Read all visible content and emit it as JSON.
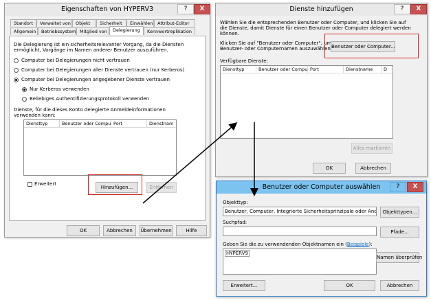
{
  "dialog_properties": {
    "title": "Eigenschaften von HYPERV3",
    "help_btn": "?",
    "close_btn": "X",
    "tabs_row1": [
      "Standort",
      "Verwaltet von",
      "Objekt",
      "Sicherheit",
      "Einwählen",
      "Attribut-Editor"
    ],
    "tabs_row2": [
      "Allgemein",
      "Betriebssystem",
      "Mitglied von",
      "Delegierung",
      "Kennwortreplikation"
    ],
    "intro_line1": "Die Delegierung ist ein sicherheitsrelevanter Vorgang, da die Diensten",
    "intro_line2": "ermöglicht, Vorgänge im Namen anderer Benutzer auszuführen.",
    "radio_no_trust": "Computer bei Delegierungen nicht vertrauen",
    "radio_all": "Computer bei Delegierungen aller Dienste vertrauen (nur Kerberos)",
    "radio_specific": "Computer bei Delegierungen angegebener Dienste vertrauen",
    "radio_kerberos": "Nur Kerberos verwenden",
    "radio_any_protocol": "Beliebiges Authentifizierungsprotokoll verwenden",
    "services_line1": "Dienste, für die dieses Konto delegierte Anmeldeinformationen",
    "services_line2": "verwenden kann:",
    "columns": [
      "Diensttyp",
      "Benutzer oder Compu...",
      "Port",
      "Dienstnam"
    ],
    "expanded_label": "Erweitert",
    "add_btn": "Hinzufügen...",
    "remove_btn": "Entfernen",
    "ok": "OK",
    "cancel": "Abbrechen",
    "apply": "Übernehmen",
    "help": "Hilfe"
  },
  "dialog_add_services": {
    "title": "Dienste hinzufügen",
    "help_btn": "?",
    "close_btn": "X",
    "intro_line1": "Wählen Sie die entsprechenden Benutzer oder Computer, und klicken Sie auf",
    "intro_line2": "die Dienste, damit Dienste für einen Benutzer oder Computer delegiert werden",
    "intro_line3": "können.",
    "click_line1": "Klicken Sie auf \"Benutzer oder Computer\", um",
    "click_line2": "Benutzer- oder Computernamen auszuwählen.",
    "users_btn": "Benutzer oder Computer...",
    "available_label": "Verfügbare Dienste:",
    "columns": [
      "Diensttyp",
      "Benutzer oder Compu...",
      "Port",
      "Dienstname",
      "D"
    ],
    "select_all": "Alles markieren",
    "ok": "OK",
    "cancel": "Abbrechen"
  },
  "dialog_select_users": {
    "title": "Benutzer oder Computer auswählen",
    "help_btn": "?",
    "close_btn": "X",
    "object_type_label": "Objekttyp:",
    "object_type_value": "Benutzer, Computer, Integrierte Sicherheitsprinzipale oder Andere Ob",
    "object_types_btn": "Objekttypen...",
    "search_path_label": "Suchpfad:",
    "search_path_value": "",
    "paths_btn": "Pfade...",
    "enter_names_prefix": "Geben Sie die zu verwendenden Objektnamen ein (",
    "examples_link": "Beispiele",
    "enter_names_suffix": "):",
    "names_value": "HYPERV9",
    "check_names_btn": "Namen überprüfen",
    "advanced_btn": "Erweitert...",
    "ok": "OK",
    "cancel": "Abbrechen"
  },
  "colors": {
    "highlight_box": "#d42020",
    "blue_titlebar": "#7cc3f0",
    "link": "#0066cc"
  }
}
